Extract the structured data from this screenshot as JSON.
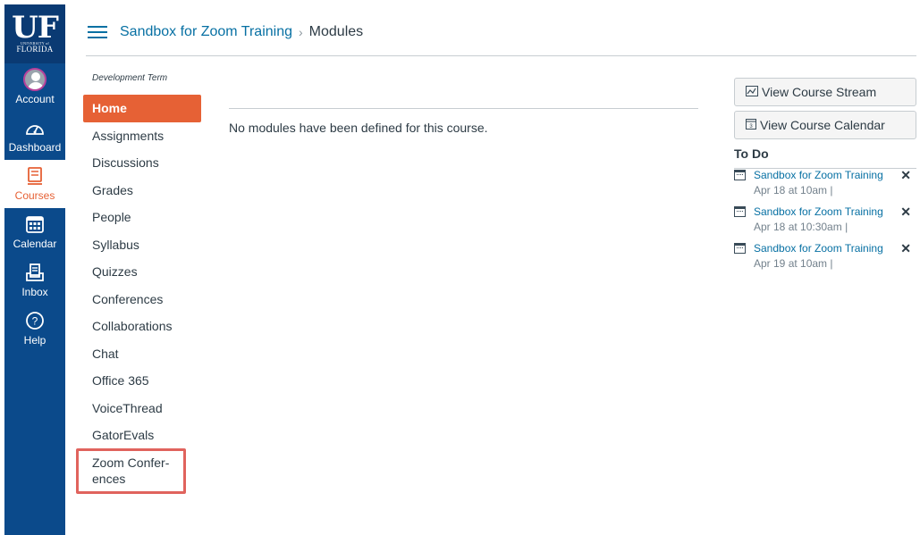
{
  "logo": {
    "main": "UF",
    "sub_small": "UNIVERSITY of",
    "sub": "FLORIDA"
  },
  "global_nav": [
    {
      "label": "Account",
      "icon": "avatar"
    },
    {
      "label": "Dashboard",
      "icon": "dashboard-icon"
    },
    {
      "label": "Courses",
      "icon": "courses-icon",
      "active": true
    },
    {
      "label": "Calendar",
      "icon": "calendar-icon"
    },
    {
      "label": "Inbox",
      "icon": "inbox-icon"
    },
    {
      "label": "Help",
      "icon": "help-icon"
    }
  ],
  "header": {
    "breadcrumb_course": "Sandbox for Zoom Training",
    "breadcrumb_separator": "›",
    "breadcrumb_current": "Modules"
  },
  "course_nav": {
    "term": "Development Term",
    "items": [
      {
        "label": "Home",
        "active": true
      },
      {
        "label": "Assignments"
      },
      {
        "label": "Discussions"
      },
      {
        "label": "Grades"
      },
      {
        "label": "People"
      },
      {
        "label": "Syllabus"
      },
      {
        "label": "Quizzes"
      },
      {
        "label": "Conferences"
      },
      {
        "label": "Collaborations"
      },
      {
        "label": "Chat"
      },
      {
        "label": "Office 365"
      },
      {
        "label": "VoiceThread"
      },
      {
        "label": "GatorEvals"
      },
      {
        "label": "Zoom Confer-\nences"
      }
    ]
  },
  "main": {
    "empty_message": "No modules have been defined for this course."
  },
  "sidebar": {
    "stream_button": "View Course Stream",
    "calendar_button": "View Course Calendar",
    "todo_title": "To Do",
    "todo": [
      {
        "title": "Sandbox for Zoom Training",
        "date": "Apr 18 at 10am  |"
      },
      {
        "title": "Sandbox for Zoom Training",
        "date": "Apr 18 at 10:30am  |"
      },
      {
        "title": "Sandbox for Zoom Training",
        "date": "Apr 19 at 10am  |"
      }
    ]
  },
  "colors": {
    "global_nav": "#0b4a8b",
    "accent": "#e66135",
    "link": "#0770a3",
    "highlight_box": "#e0635d"
  }
}
